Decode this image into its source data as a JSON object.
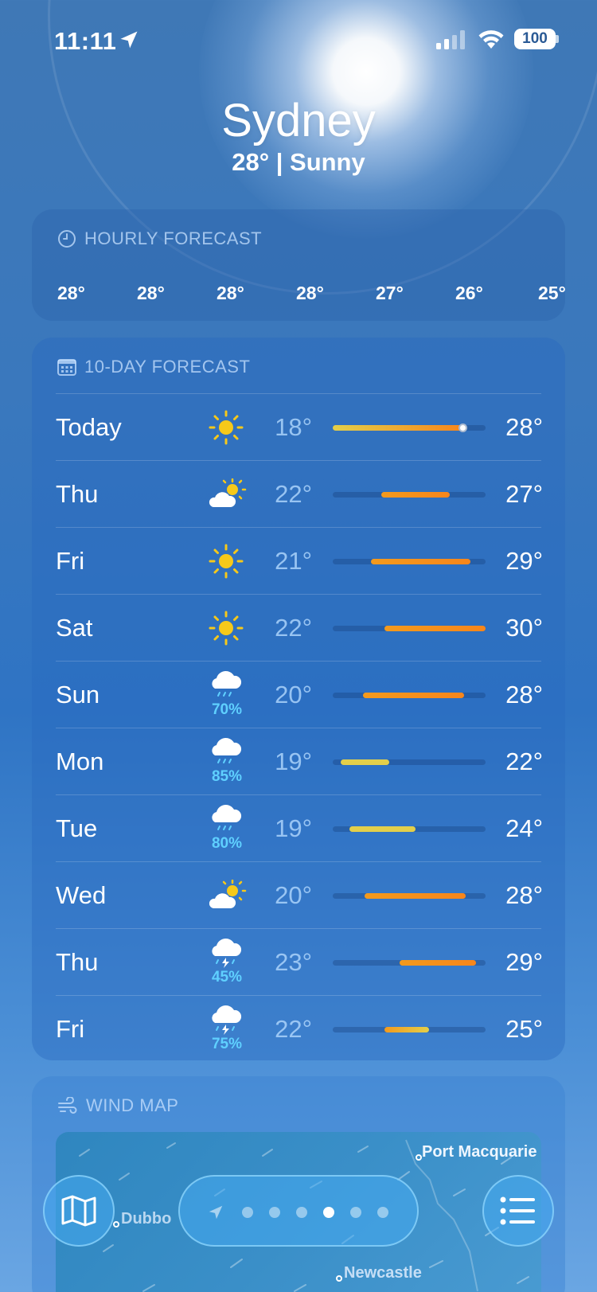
{
  "status_bar": {
    "time": "11:11",
    "battery": "100"
  },
  "header": {
    "city": "Sydney",
    "summary": "28°  |  Sunny"
  },
  "hourly": {
    "title": "HOURLY FORECAST",
    "temps": [
      "28°",
      "28°",
      "28°",
      "28°",
      "27°",
      "26°",
      "25°"
    ]
  },
  "ten_day": {
    "title": "10-DAY FORECAST",
    "days": [
      {
        "day": "Today",
        "icon": "sun-icon",
        "precip": "",
        "low": "18°",
        "high": "28°",
        "bar_start": 0.0,
        "bar_end": 0.85,
        "current": 0.85
      },
      {
        "day": "Thu",
        "icon": "partly-sunny-icon",
        "precip": "",
        "low": "22°",
        "high": "27°",
        "bar_start": 0.32,
        "bar_end": 0.77
      },
      {
        "day": "Fri",
        "icon": "sun-icon",
        "precip": "",
        "low": "21°",
        "high": "29°",
        "bar_start": 0.25,
        "bar_end": 0.9
      },
      {
        "day": "Sat",
        "icon": "sun-icon",
        "precip": "",
        "low": "22°",
        "high": "30°",
        "bar_start": 0.34,
        "bar_end": 1.0
      },
      {
        "day": "Sun",
        "icon": "rain-cloud-icon",
        "precip": "70%",
        "low": "20°",
        "high": "28°",
        "bar_start": 0.2,
        "bar_end": 0.86
      },
      {
        "day": "Mon",
        "icon": "rain-cloud-icon",
        "precip": "85%",
        "low": "19°",
        "high": "22°",
        "bar_start": 0.05,
        "bar_end": 0.37
      },
      {
        "day": "Tue",
        "icon": "rain-cloud-icon",
        "precip": "80%",
        "low": "19°",
        "high": "24°",
        "bar_start": 0.11,
        "bar_end": 0.54
      },
      {
        "day": "Wed",
        "icon": "partly-sunny-icon",
        "precip": "",
        "low": "20°",
        "high": "28°",
        "bar_start": 0.21,
        "bar_end": 0.87
      },
      {
        "day": "Thu",
        "icon": "thunderstorm-icon",
        "precip": "45%",
        "low": "23°",
        "high": "29°",
        "bar_start": 0.44,
        "bar_end": 0.94
      },
      {
        "day": "Fri",
        "icon": "thunderstorm-icon",
        "precip": "75%",
        "low": "22°",
        "high": "25°",
        "bar_start": 0.34,
        "bar_end": 0.63
      }
    ]
  },
  "wind_map": {
    "title": "WIND MAP",
    "labels": [
      "Port Macquarie",
      "Dubbo",
      "Newcastle"
    ]
  },
  "colors": {
    "precip": "#5fd0ff",
    "bar_cool": "#e3cf4a",
    "bar_warm": "#f39a1d",
    "bar_hot": "#f7861b"
  }
}
